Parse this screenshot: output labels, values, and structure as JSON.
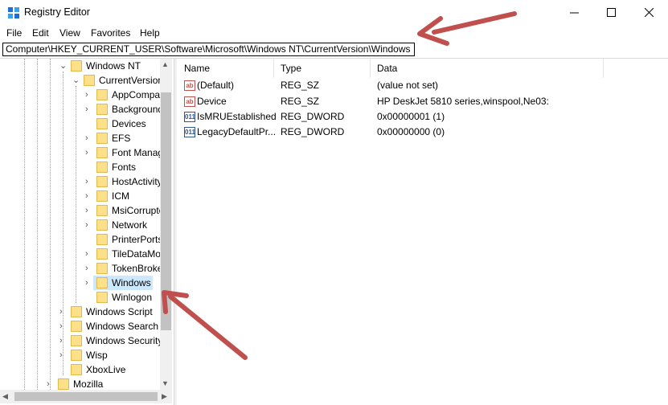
{
  "window": {
    "title": "Registry Editor",
    "icon": "registry-icon",
    "controls": {
      "minimize": "—",
      "maximize": "☐",
      "close": "✕"
    }
  },
  "menu": [
    "File",
    "Edit",
    "View",
    "Favorites",
    "Help"
  ],
  "address": "Computer\\HKEY_CURRENT_USER\\Software\\Microsoft\\Windows NT\\CurrentVersion\\Windows",
  "tree": {
    "items": [
      {
        "label": "Windows NT",
        "expanded": true
      },
      {
        "label": "CurrentVersion",
        "expanded": true
      },
      {
        "label": "AppCompatFlags",
        "expandable": true
      },
      {
        "label": "BackgroundModel",
        "expandable": true
      },
      {
        "label": "Devices",
        "expandable": false
      },
      {
        "label": "EFS",
        "expandable": true
      },
      {
        "label": "Font Management",
        "expandable": true
      },
      {
        "label": "Fonts",
        "expandable": false
      },
      {
        "label": "HostActivityManager",
        "expandable": true
      },
      {
        "label": "ICM",
        "expandable": true
      },
      {
        "label": "MsiCorruptedFileRecovery",
        "expandable": true
      },
      {
        "label": "Network",
        "expandable": true
      },
      {
        "label": "PrinterPorts",
        "expandable": false
      },
      {
        "label": "TileDataModel",
        "expandable": true
      },
      {
        "label": "TokenBroker",
        "expandable": true
      },
      {
        "label": "Windows",
        "expandable": true,
        "selected": true
      },
      {
        "label": "Winlogon",
        "expandable": false
      },
      {
        "label": "Windows Script",
        "expandable": true
      },
      {
        "label": "Windows Search",
        "expandable": true
      },
      {
        "label": "Windows Security Health",
        "expandable": true
      },
      {
        "label": "Wisp",
        "expandable": true
      },
      {
        "label": "XboxLive",
        "expandable": false
      },
      {
        "label": "Mozilla",
        "expandable": true
      }
    ]
  },
  "list": {
    "columns": [
      "Name",
      "Type",
      "Data"
    ],
    "rows": [
      {
        "icon": "string-value-icon",
        "icon_text": "ab",
        "name": "(Default)",
        "type": "REG_SZ",
        "data": "(value not set)"
      },
      {
        "icon": "string-value-icon",
        "icon_text": "ab",
        "name": "Device",
        "type": "REG_SZ",
        "data": "HP DeskJet 5810 series,winspool,Ne03:"
      },
      {
        "icon": "dword-value-icon",
        "icon_text": "011",
        "name": "IsMRUEstablished",
        "type": "REG_DWORD",
        "data": "0x00000001 (1)"
      },
      {
        "icon": "dword-value-icon",
        "icon_text": "011",
        "name": "LegacyDefaultPr...",
        "type": "REG_DWORD",
        "data": "0x00000000 (0)"
      }
    ]
  },
  "colors": {
    "arrow": "#c0504d",
    "selection": "#cce8ff",
    "folder": "#fde08a"
  }
}
